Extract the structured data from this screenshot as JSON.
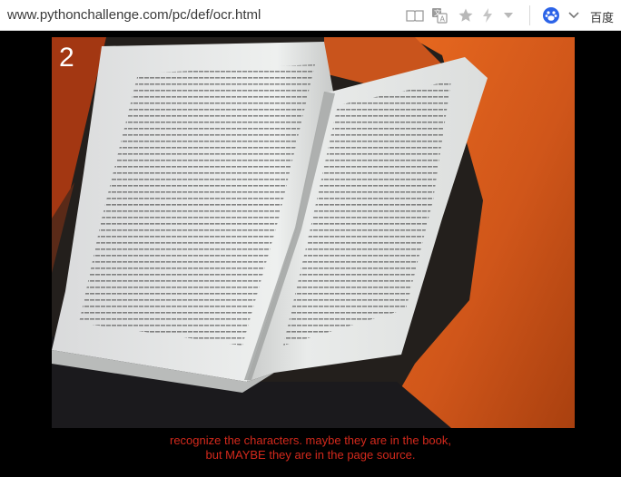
{
  "browser": {
    "url": "www.pythonchallenge.com/pc/def/ocr.html",
    "search_engine_label": "百度",
    "icons": [
      "reader-icon",
      "translate-icon",
      "star-icon",
      "lightning-icon",
      "dropdown-icon",
      "baidu-paw-icon",
      "chevron-down-icon"
    ]
  },
  "page": {
    "level_number": "2",
    "image_alt": "open book",
    "caption_line1": "recognize the characters. maybe they are in the book,",
    "caption_line2": "but MAYBE they are in the page source."
  },
  "colors": {
    "background": "#000000",
    "caption": "#d3291c",
    "pillow": "#d85a1c",
    "paper": "#e6e7e6"
  }
}
